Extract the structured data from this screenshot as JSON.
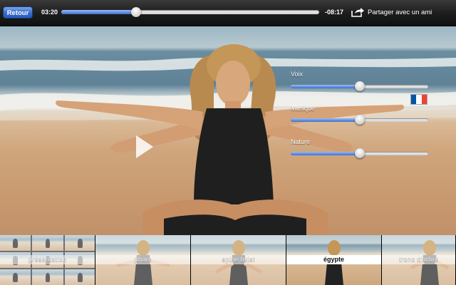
{
  "toolbar": {
    "back_label": "Retour",
    "elapsed": "03:20",
    "remaining": "-08:17",
    "share_label": "Partager avec un ami",
    "progress_fraction": 0.29
  },
  "mixer": {
    "language_flag": "fr",
    "flag_colors": [
      "#0055A4",
      "#FFFFFF",
      "#EF4135"
    ],
    "channels": [
      {
        "label": "Voix",
        "level": 0.5
      },
      {
        "label": "Musique",
        "level": 0.5
      },
      {
        "label": "Nature",
        "level": 0.5
      }
    ]
  },
  "chapters": [
    {
      "label": "présentation",
      "active": false
    },
    {
      "label": "phare",
      "active": false
    },
    {
      "label": "spine twist",
      "active": false
    },
    {
      "label": "égypte",
      "active": true
    },
    {
      "label": "tronc d'arbre",
      "active": false
    }
  ],
  "colors": {
    "accent": "#3a6fd0",
    "track": "#e6e6e6"
  }
}
